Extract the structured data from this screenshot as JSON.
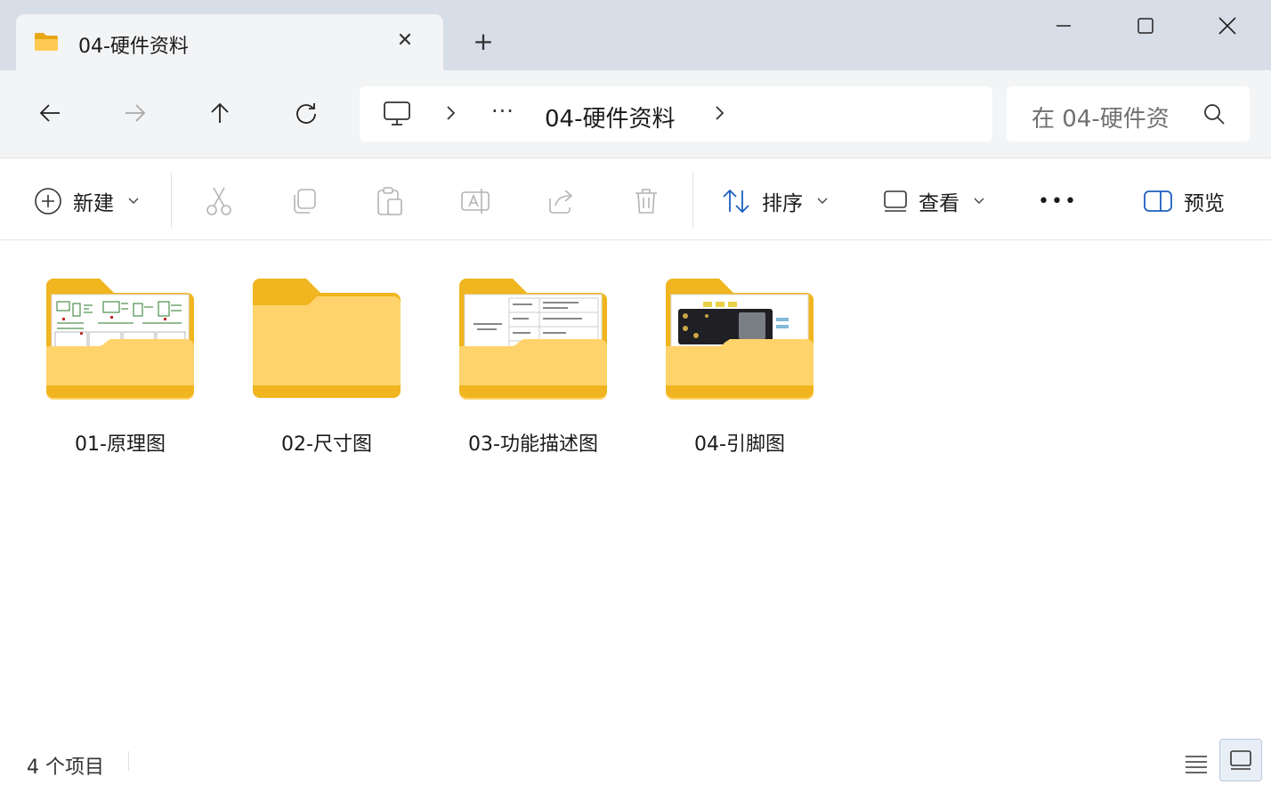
{
  "window": {
    "tab_title": "04-硬件资料",
    "tab_close_glyph": "✕",
    "new_tab_glyph": "+"
  },
  "address": {
    "more_glyph": "···",
    "folder": "04-硬件资料"
  },
  "search": {
    "placeholder": "在 04-硬件资"
  },
  "toolbar": {
    "new_label": "新建",
    "sort_label": "排序",
    "view_label": "查看",
    "more_glyph": "•••",
    "preview_label": "预览"
  },
  "items": [
    {
      "name": "01-原理图",
      "thumbnail": "schematic"
    },
    {
      "name": "02-尺寸图",
      "thumbnail": "empty"
    },
    {
      "name": "03-功能描述图",
      "thumbnail": "spec-table"
    },
    {
      "name": "04-引脚图",
      "thumbnail": "board-photo"
    }
  ],
  "status": {
    "count_text": "4 个项目"
  },
  "colors": {
    "accent": "#1e5fbf",
    "folder_back": "#f0b51f",
    "folder_front": "#ffd36b",
    "chrome_bg": "#d8dee7",
    "nav_bg": "#f3f4f6"
  }
}
